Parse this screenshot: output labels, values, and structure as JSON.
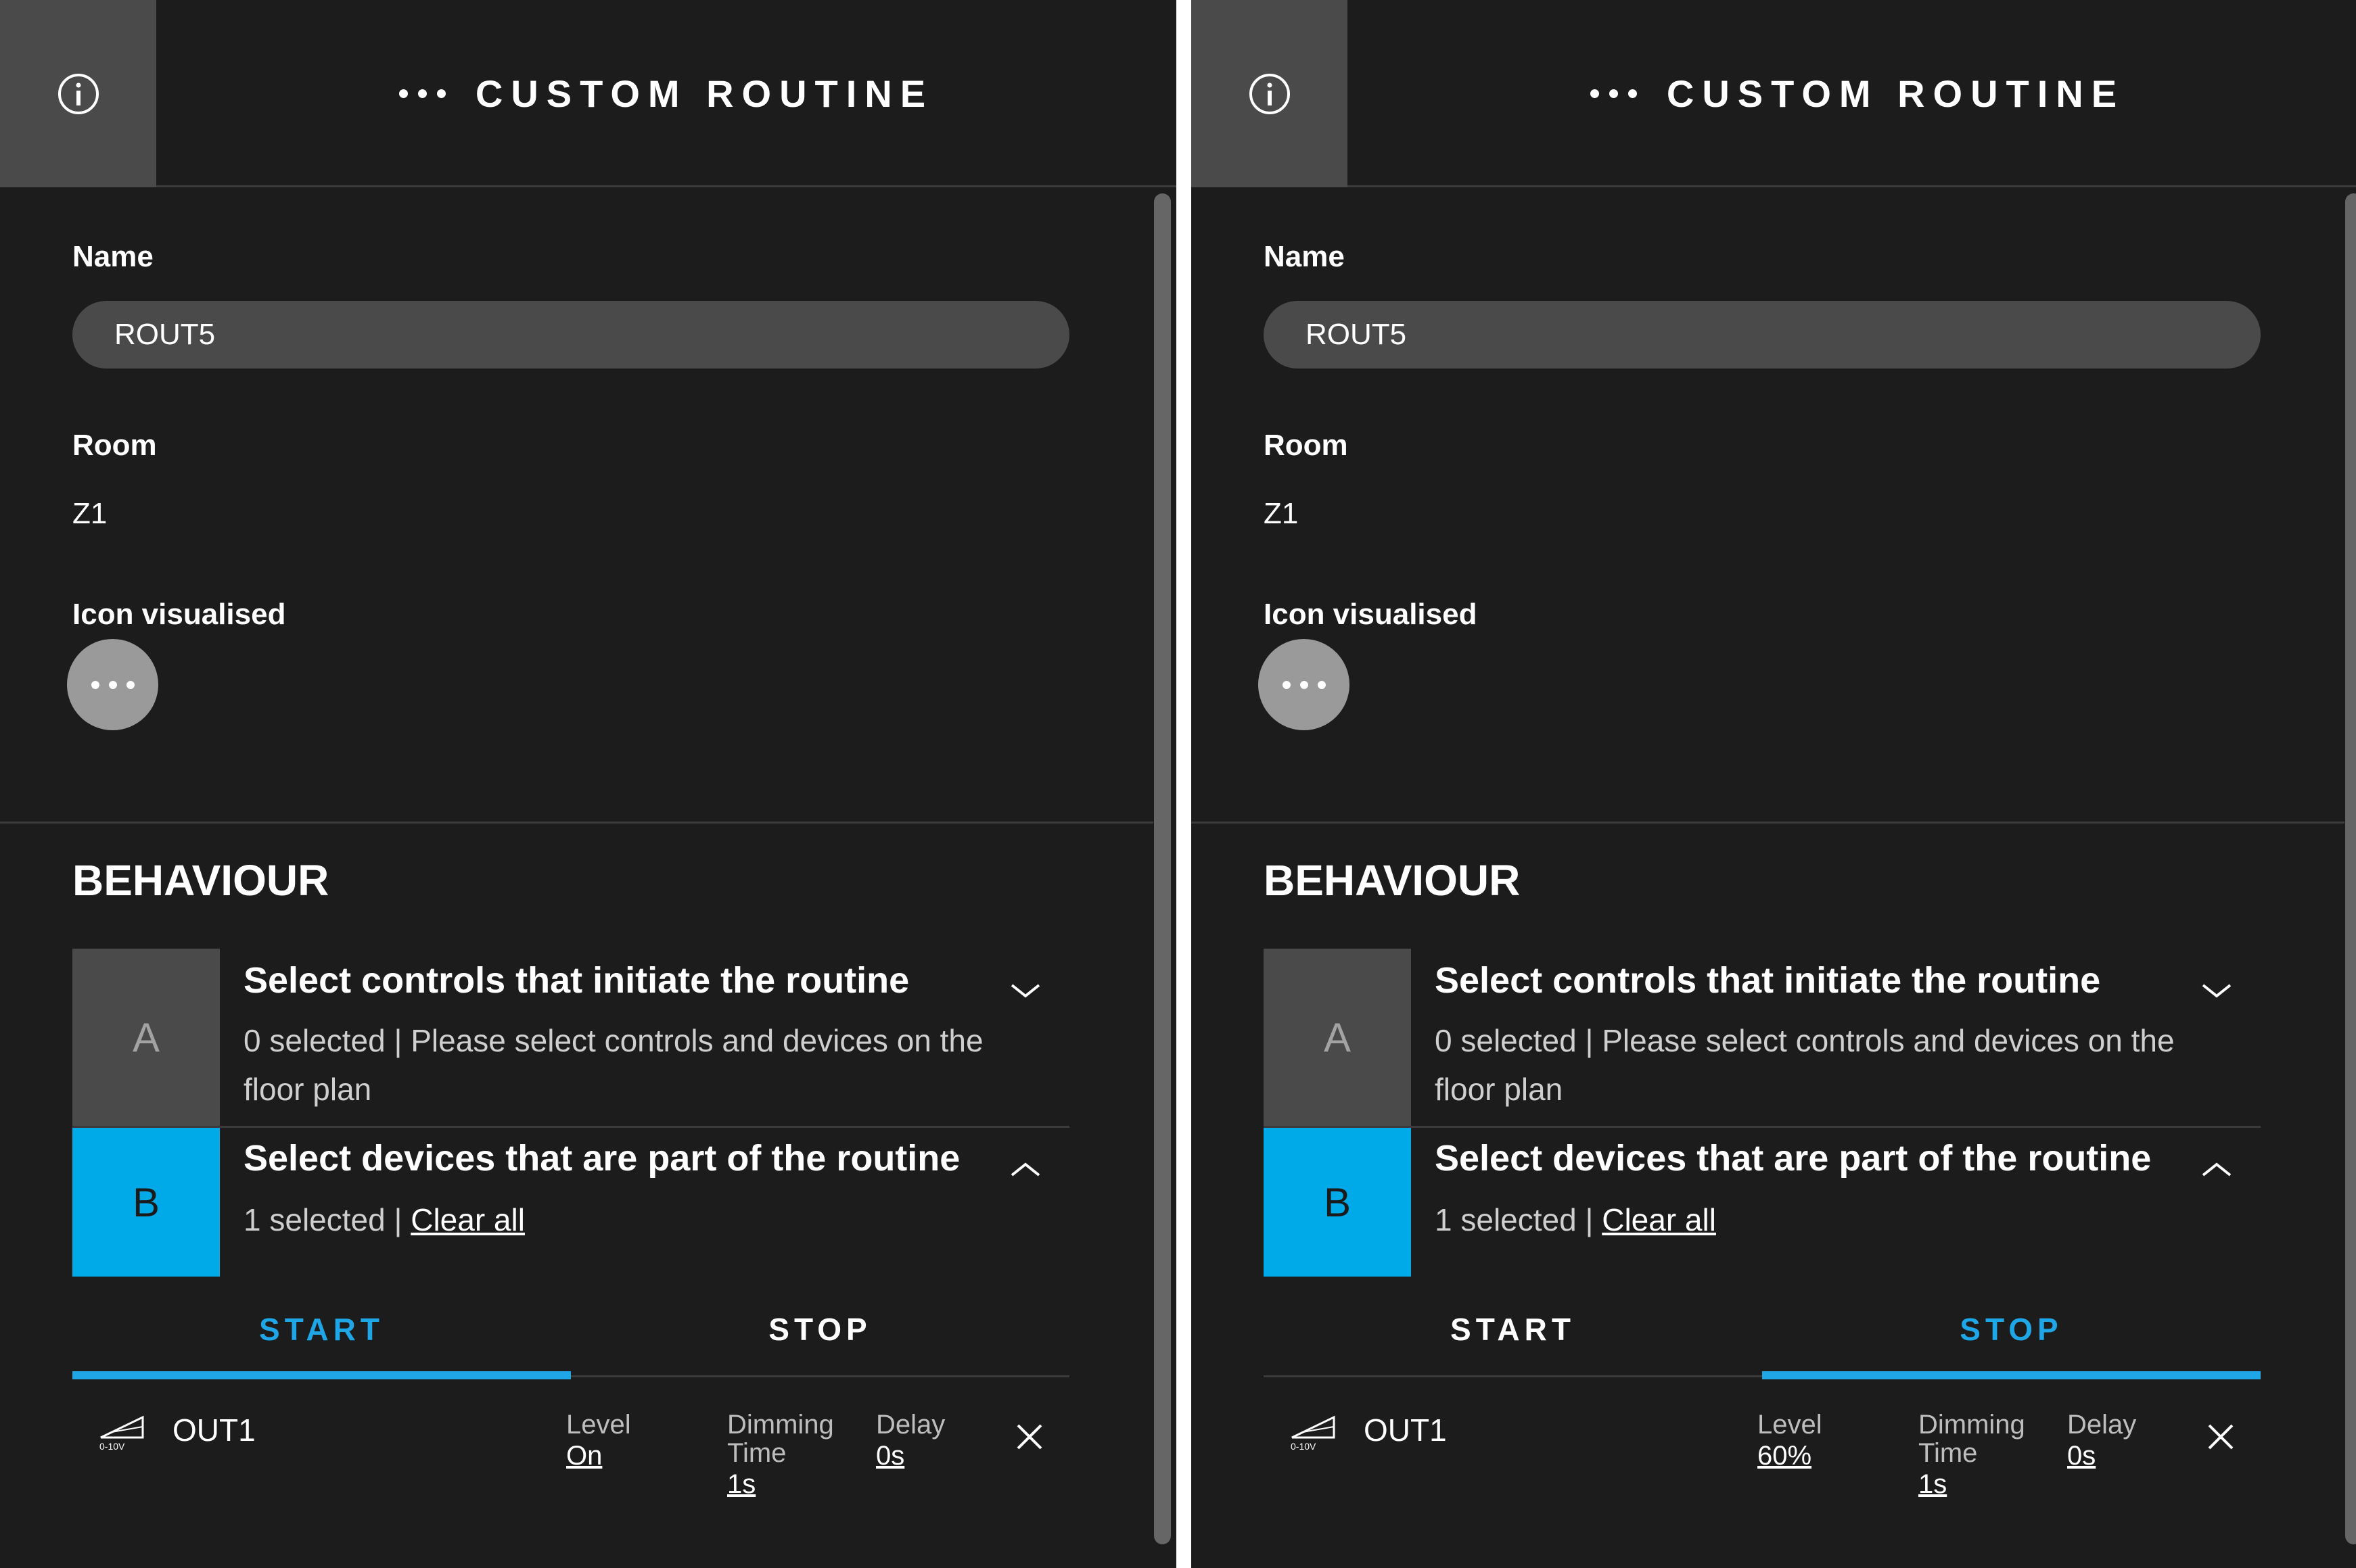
{
  "panels": [
    {
      "header": {
        "title": "CUSTOM ROUTINE",
        "info_icon": "info-icon"
      },
      "form": {
        "name_label": "Name",
        "name_value": "ROUT5",
        "room_label": "Room",
        "room_value": "Z1",
        "icon_label": "Icon visualised"
      },
      "behaviour": {
        "title": "BEHAVIOUR",
        "step_a": {
          "letter": "A",
          "title": "Select controls that initiate the routine",
          "subtitle": "0 selected | Please select controls and devices on the floor plan"
        },
        "step_b": {
          "letter": "B",
          "title": "Select devices that are part of the routine",
          "count": "1 selected | ",
          "clear": "Clear all"
        },
        "tabs": [
          {
            "label": "START",
            "active": true
          },
          {
            "label": "STOP",
            "active": false
          }
        ],
        "device": {
          "name": "OUT1",
          "icon_caption": "0-10V",
          "level_label": "Level",
          "level_value": "On",
          "dimming_label": "Dimming Time",
          "dimming_value": "1s",
          "delay_label": "Delay",
          "delay_value": "0s"
        }
      }
    },
    {
      "header": {
        "title": "CUSTOM ROUTINE",
        "info_icon": "info-icon"
      },
      "form": {
        "name_label": "Name",
        "name_value": "ROUT5",
        "room_label": "Room",
        "room_value": "Z1",
        "icon_label": "Icon visualised"
      },
      "behaviour": {
        "title": "BEHAVIOUR",
        "step_a": {
          "letter": "A",
          "title": "Select controls that initiate the routine",
          "subtitle": "0 selected | Please select controls and devices on the floor plan"
        },
        "step_b": {
          "letter": "B",
          "title": "Select devices that are part of the routine",
          "count": "1 selected | ",
          "clear": "Clear all"
        },
        "tabs": [
          {
            "label": "START",
            "active": false
          },
          {
            "label": "STOP",
            "active": true
          }
        ],
        "device": {
          "name": "OUT1",
          "icon_caption": "0-10V",
          "level_label": "Level",
          "level_value": "60%",
          "dimming_label": "Dimming Time",
          "dimming_value": "1s",
          "delay_label": "Delay",
          "delay_value": "0s"
        }
      }
    }
  ],
  "colors": {
    "background": "#1c1c1d",
    "accent": "#00a9e8",
    "input": "#4a4a4b"
  }
}
